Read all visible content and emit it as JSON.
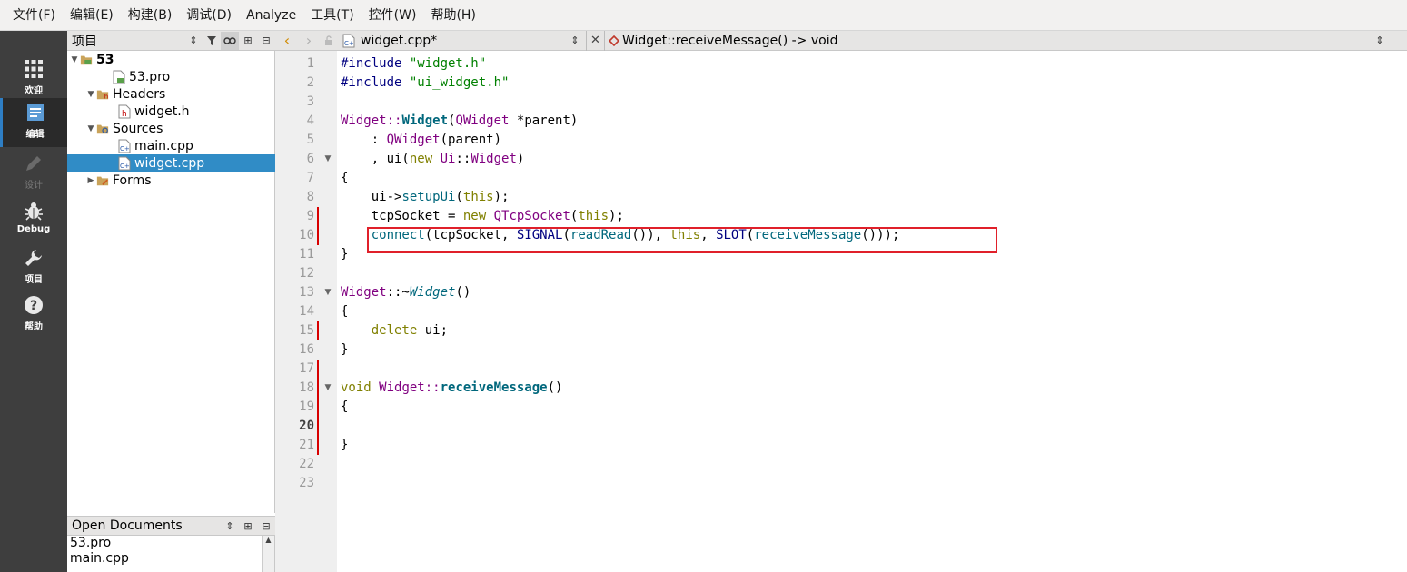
{
  "menu": [
    "文件(F)",
    "编辑(E)",
    "构建(B)",
    "调试(D)",
    "Analyze",
    "工具(T)",
    "控件(W)",
    "帮助(H)"
  ],
  "modes": [
    {
      "label": "欢迎",
      "icon": "grid-icon"
    },
    {
      "label": "编辑",
      "icon": "edit-document-icon"
    },
    {
      "label": "设计",
      "icon": "pencil-icon"
    },
    {
      "label": "Debug",
      "icon": "bug-icon"
    },
    {
      "label": "项目",
      "icon": "wrench-icon"
    },
    {
      "label": "帮助",
      "icon": "help-icon"
    }
  ],
  "project_panel": {
    "title": "项目"
  },
  "tree": [
    {
      "label": "53"
    },
    {
      "label": "53.pro"
    },
    {
      "label": "Headers"
    },
    {
      "label": "widget.h"
    },
    {
      "label": "Sources"
    },
    {
      "label": "main.cpp"
    },
    {
      "label": "widget.cpp"
    },
    {
      "label": "Forms"
    }
  ],
  "open_documents": {
    "title": "Open Documents",
    "items": [
      "53.pro",
      "main.cpp"
    ]
  },
  "editor": {
    "file_name": "widget.cpp*",
    "symbol": "Widget::receiveMessage() -> void",
    "current_line": 20
  },
  "code": {
    "l1a": "#include ",
    "l1b": "\"widget.h\"",
    "l2a": "#include ",
    "l2b": "\"ui_widget.h\"",
    "l4a": "Widget",
    "l4b": "::",
    "l4c": "Widget",
    "l4d": "(",
    "l4e": "QWidget",
    "l4f": " *parent)",
    "l5a": "    : ",
    "l5b": "QWidget",
    "l5c": "(parent)",
    "l6a": "    , ui(",
    "l6b": "new",
    "l6c": " ",
    "l6d": "Ui",
    "l6e": "::",
    "l6f": "Widget",
    "l6g": ")",
    "l7": "{",
    "l8a": "    ui->",
    "l8b": "setupUi",
    "l8c": "(",
    "l8d": "this",
    "l8e": ");",
    "l9a": "    tcpSocket = ",
    "l9b": "new",
    "l9c": " ",
    "l9d": "QTcpSocket",
    "l9e": "(",
    "l9f": "this",
    "l9g": ");",
    "l10a": "    ",
    "l10b": "connect",
    "l10c": "(tcpSocket, ",
    "l10d": "SIGNAL",
    "l10e": "(",
    "l10f": "readRead",
    "l10g": "()), ",
    "l10h": "this",
    "l10i": ", ",
    "l10j": "SLOT",
    "l10k": "(",
    "l10l": "receiveMessage",
    "l10m": "()));",
    "l11": "}",
    "l13a": "Widget",
    "l13b": "::~",
    "l13c": "Widget",
    "l13d": "()",
    "l14": "{",
    "l15a": "    ",
    "l15b": "delete",
    "l15c": " ui;",
    "l16": "}",
    "l18a": "void",
    "l18b": " ",
    "l18c": "Widget",
    "l18d": "::",
    "l18e": "receiveMessage",
    "l18f": "()",
    "l19": "{",
    "l21": "}"
  },
  "line_numbers": [
    "1",
    "2",
    "3",
    "4",
    "5",
    "6",
    "7",
    "8",
    "9",
    "10",
    "11",
    "12",
    "13",
    "14",
    "15",
    "16",
    "17",
    "18",
    "19",
    "20",
    "21",
    "22",
    "23"
  ]
}
